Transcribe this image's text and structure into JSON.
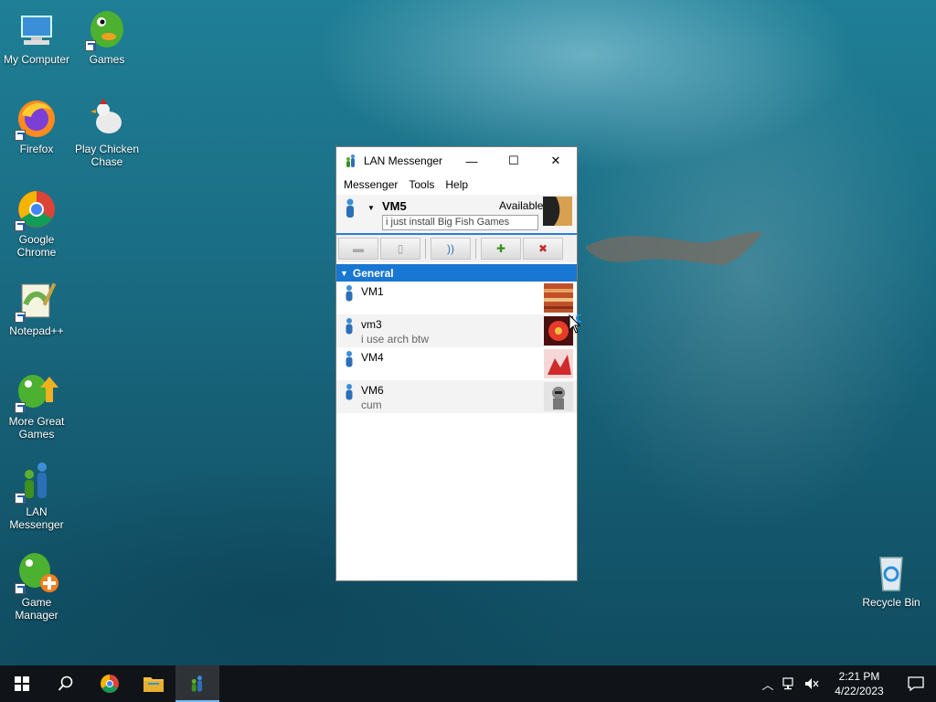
{
  "desktop": {
    "icons": [
      {
        "label": "My Computer",
        "icon": "computer-icon"
      },
      {
        "label": "Games",
        "icon": "fish-icon"
      },
      {
        "label": "Firefox",
        "icon": "firefox-icon"
      },
      {
        "label": "Play Chicken Chase",
        "icon": "chicken-icon"
      },
      {
        "label": "Google Chrome",
        "icon": "chrome-icon"
      },
      {
        "label": "Notepad++",
        "icon": "notepad-icon"
      },
      {
        "label": "More Great Games",
        "icon": "fish-arrow-icon"
      },
      {
        "label": "LAN Messenger",
        "icon": "lan-messenger-icon"
      },
      {
        "label": "Game Manager",
        "icon": "fish-plus-icon"
      },
      {
        "label": "Recycle Bin",
        "icon": "recycle-bin-icon"
      }
    ]
  },
  "window": {
    "title": "LAN Messenger",
    "menu": [
      "Messenger",
      "Tools",
      "Help"
    ],
    "profile": {
      "name": "VM5",
      "status": "Available",
      "note": "i just install Big Fish Games"
    },
    "group": "General",
    "contacts": [
      {
        "name": "VM1",
        "note": ""
      },
      {
        "name": "vm3",
        "note": "i use arch btw"
      },
      {
        "name": "VM4",
        "note": ""
      },
      {
        "name": "VM6",
        "note": "cum"
      }
    ]
  },
  "taskbar": {
    "time": "2:21 PM",
    "date": "4/22/2023"
  },
  "colors": {
    "accent": "#1877d2",
    "taskbar": "#101418"
  }
}
